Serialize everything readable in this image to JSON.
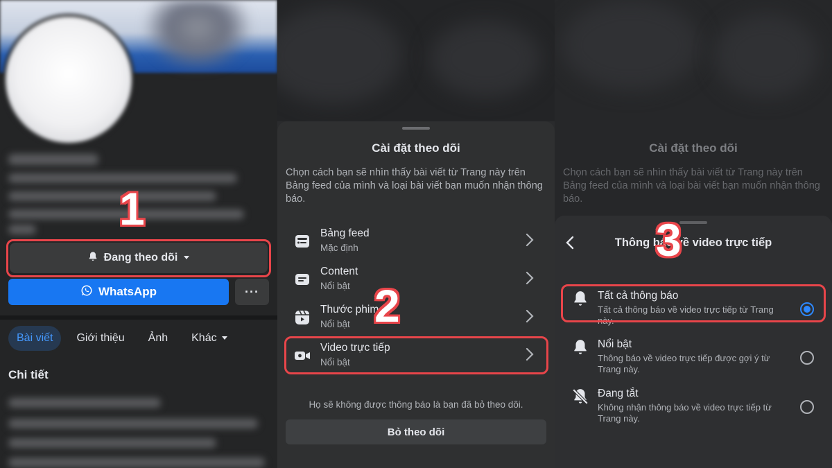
{
  "colors": {
    "accent_blue": "#1877f2",
    "highlight_red": "#e8454a",
    "background_dark": "#242526"
  },
  "step_numbers": [
    "1",
    "2",
    "3"
  ],
  "profile": {
    "follow_button_label": "Đang theo dõi",
    "whatsapp_button_label": "WhatsApp",
    "more_button_label": "···",
    "tabs": [
      {
        "label": "Bài viết",
        "active": true
      },
      {
        "label": "Giới thiệu",
        "active": false
      },
      {
        "label": "Ảnh",
        "active": false
      },
      {
        "label": "Khác",
        "active": false
      }
    ],
    "details_heading": "Chi tiết"
  },
  "follow_settings": {
    "title": "Cài đặt theo dõi",
    "description": "Chọn cách bạn sẽ nhìn thấy bài viết từ Trang này trên Bảng feed của mình và loại bài viết bạn muốn nhận thông báo.",
    "options": [
      {
        "icon": "feed-icon",
        "label": "Bảng feed",
        "value": "Mặc định"
      },
      {
        "icon": "content-icon",
        "label": "Content",
        "value": "Nổi bật"
      },
      {
        "icon": "reels-icon",
        "label": "Thước phim",
        "value": "Nổi bật"
      },
      {
        "icon": "video-camera-icon",
        "label": "Video trực tiếp",
        "value": "Nổi bật"
      }
    ],
    "note": "Họ sẽ không được thông báo là bạn đã bỏ theo dõi.",
    "unfollow_label": "Bỏ theo dõi"
  },
  "live_video_notifications": {
    "title": "Thông báo về video trực tiếp",
    "options": [
      {
        "icon": "bell-icon",
        "label": "Tất cả thông báo",
        "description": "Tất cả thông báo về video trực tiếp từ Trang này.",
        "selected": true
      },
      {
        "icon": "bell-icon",
        "label": "Nổi bật",
        "description": "Thông báo về video trực tiếp được gợi ý từ Trang này.",
        "selected": false
      },
      {
        "icon": "bell-off-icon",
        "label": "Đang tắt",
        "description": "Không nhận thông báo về video trực tiếp từ Trang này.",
        "selected": false
      }
    ]
  }
}
